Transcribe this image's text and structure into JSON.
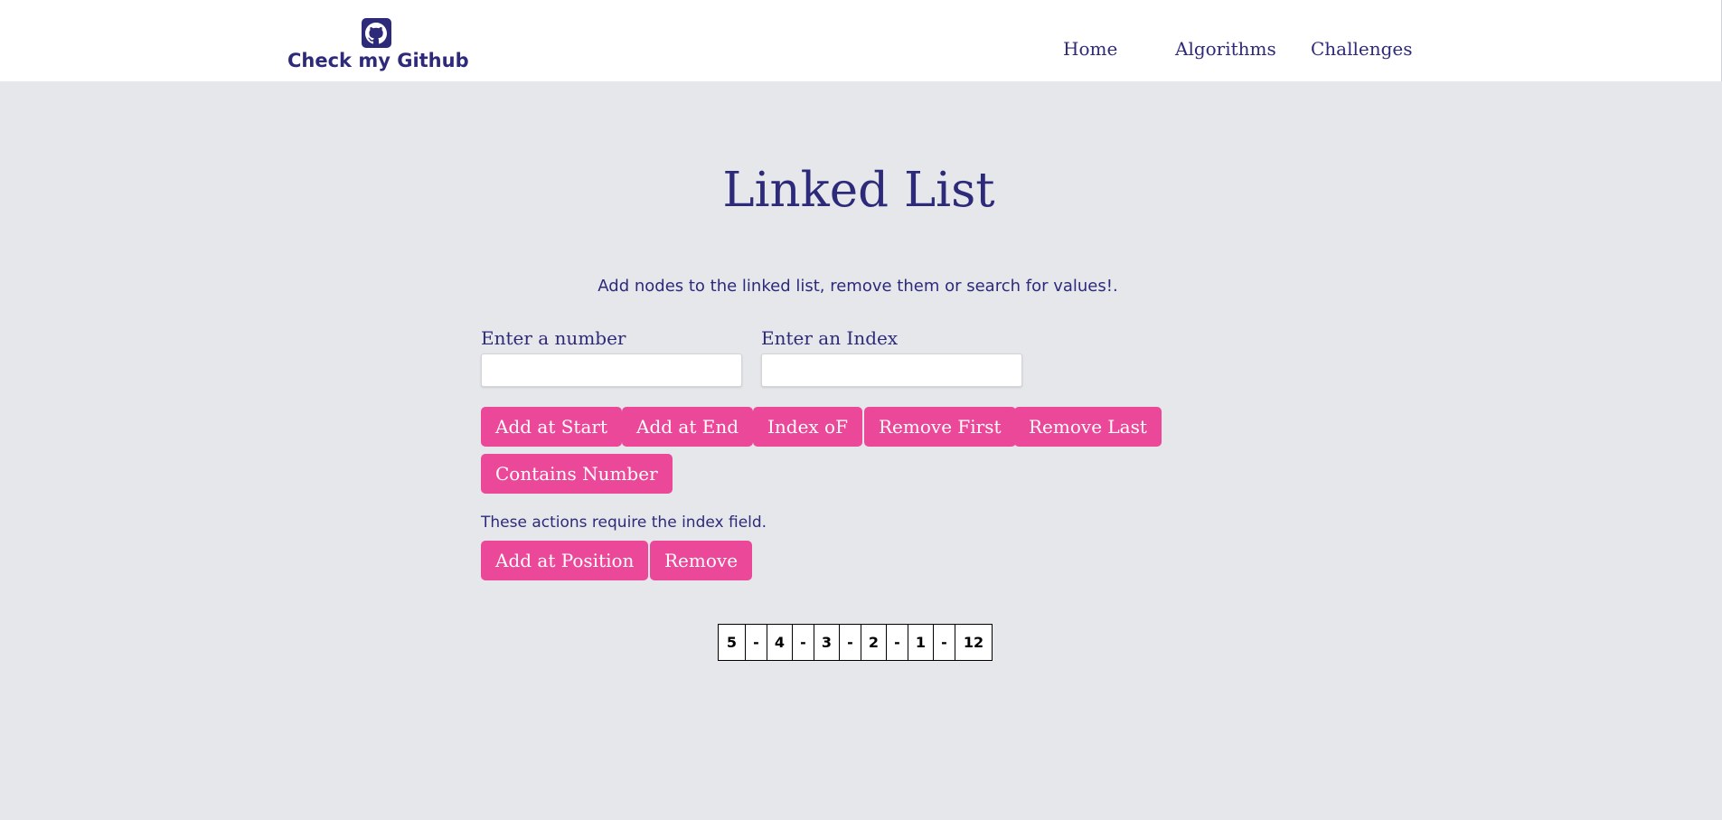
{
  "header": {
    "brand_label": "Check my Github",
    "brand_icon": "github-icon",
    "nav": [
      "Home",
      "Algorithms",
      "Challenges"
    ]
  },
  "main": {
    "title": "Linked List",
    "subtitle": "Add nodes to the linked list, remove them or search for values!.",
    "number_label": "Enter a number",
    "index_label": "Enter an Index",
    "number_value": "",
    "index_value": "",
    "buttons": [
      "Add at Start",
      "Add at End",
      "Index oF",
      "Remove First",
      "Remove Last",
      "Contains Number"
    ],
    "note": "These actions require the index field.",
    "index_buttons": [
      "Add at Position",
      "Remove"
    ]
  },
  "linked_list": [
    "5",
    "-",
    "4",
    "-",
    "3",
    "-",
    "2",
    "-",
    "1",
    "-",
    "12"
  ],
  "colors": {
    "accent": "#ec4899",
    "primary_text": "#2e2a7a",
    "page_background": "#e5e7eb",
    "header_background": "#ffffff"
  }
}
